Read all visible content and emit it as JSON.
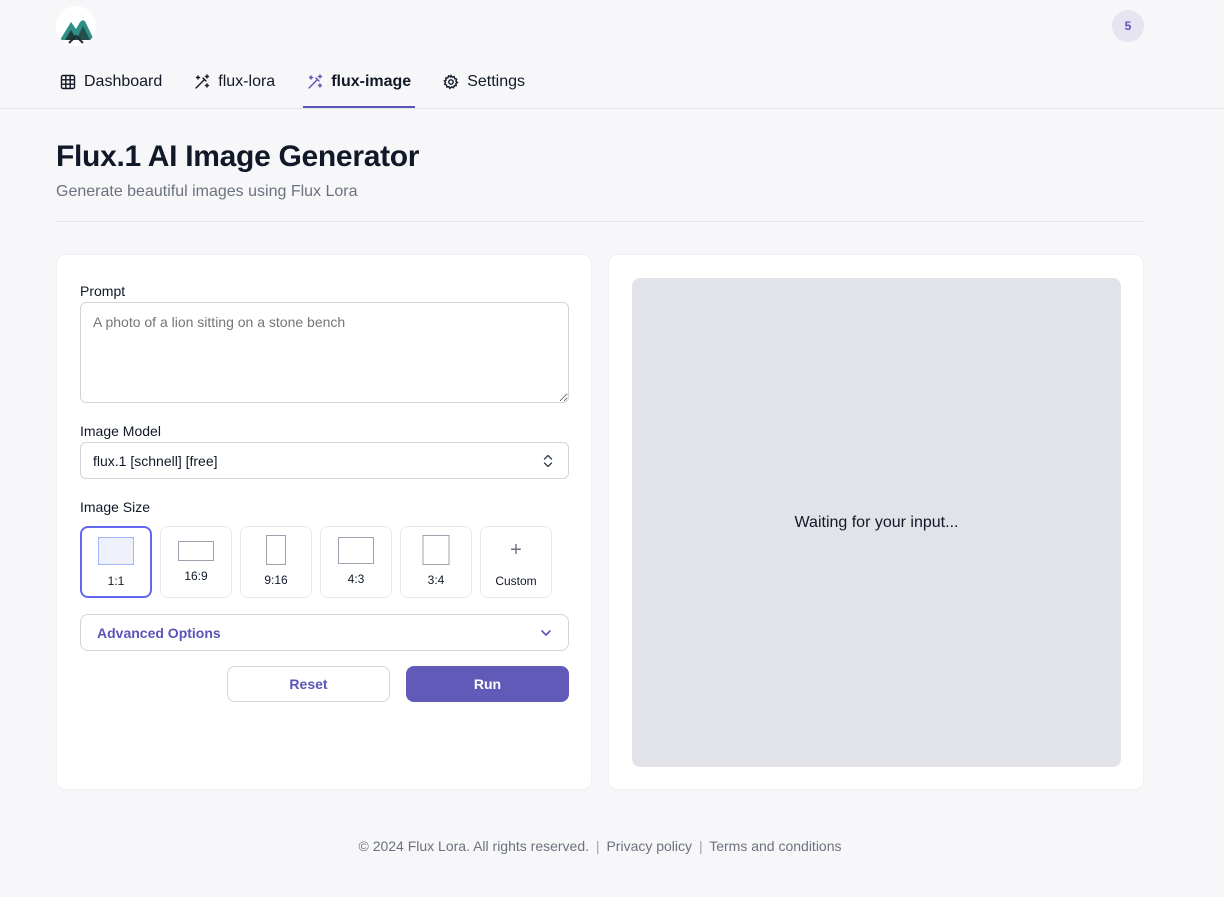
{
  "header": {
    "logo": "mountain-logo",
    "badge": "5"
  },
  "nav": {
    "items": [
      {
        "label": "Dashboard",
        "icon": "grid-icon",
        "active": false
      },
      {
        "label": "flux-lora",
        "icon": "magic-wand-icon",
        "active": false
      },
      {
        "label": "flux-image",
        "icon": "magic-wand-icon",
        "active": true
      },
      {
        "label": "Settings",
        "icon": "gear-icon",
        "active": false
      }
    ]
  },
  "page": {
    "title": "Flux.1 AI Image Generator",
    "subtitle": "Generate beautiful images using Flux Lora"
  },
  "form": {
    "prompt_label": "Prompt",
    "prompt_placeholder": "A photo of a lion sitting on a stone bench",
    "model_label": "Image Model",
    "model_value": "flux.1 [schnell] [free]",
    "size_label": "Image Size",
    "sizes": [
      {
        "label": "1:1",
        "selected": true
      },
      {
        "label": "16:9",
        "selected": false
      },
      {
        "label": "9:16",
        "selected": false
      },
      {
        "label": "4:3",
        "selected": false
      },
      {
        "label": "3:4",
        "selected": false
      },
      {
        "label": "Custom",
        "selected": false
      }
    ],
    "advanced_label": "Advanced Options",
    "reset_label": "Reset",
    "run_label": "Run"
  },
  "preview": {
    "status": "Waiting for your input..."
  },
  "footer": {
    "copyright": "© 2024 Flux Lora. All rights reserved.",
    "privacy": "Privacy policy",
    "terms": "Terms and conditions",
    "separator": "|"
  },
  "colors": {
    "accent": "#625ab9",
    "accent_text": "#5b55b8",
    "selected_border": "#6366f1",
    "page_bg": "#f7f7f9",
    "preview_bg": "#e2e3e8"
  }
}
